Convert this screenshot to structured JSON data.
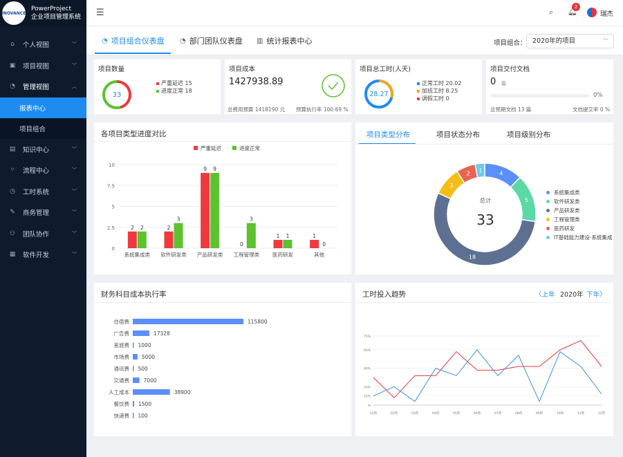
{
  "app": {
    "logo": "INOVANCE",
    "name": "PowerProject",
    "subtitle": "企业项目管理系统"
  },
  "topbar": {
    "notification_count": "2",
    "user": "瑞杰"
  },
  "sidebar": {
    "items": [
      {
        "label": "个人视图",
        "icon": "home-icon",
        "glyph": "⌂"
      },
      {
        "label": "项目视图",
        "icon": "project-icon",
        "glyph": "▣"
      },
      {
        "label": "管理视图",
        "icon": "dashboard-icon",
        "glyph": "◔"
      },
      {
        "label": "知识中心",
        "icon": "book-icon",
        "glyph": "▤"
      },
      {
        "label": "流程中心",
        "icon": "flow-icon",
        "glyph": "⑂"
      },
      {
        "label": "工时系统",
        "icon": "clock-icon",
        "glyph": "◷"
      },
      {
        "label": "商务管理",
        "icon": "contract-icon",
        "glyph": "✎"
      },
      {
        "label": "团队协作",
        "icon": "team-icon",
        "glyph": "⚇"
      },
      {
        "label": "软件开发",
        "icon": "grid-icon",
        "glyph": "▦"
      }
    ],
    "sub_items": [
      {
        "label": "报表中心"
      },
      {
        "label": "项目组合"
      }
    ]
  },
  "tabs": [
    {
      "label": "项目组合仪表盘"
    },
    {
      "label": "部门团队仪表盘"
    },
    {
      "label": "统计报表中心"
    }
  ],
  "portfolio": {
    "label": "项目组合：",
    "value": "2020年的项目"
  },
  "kpi": {
    "count": {
      "title": "项目数量",
      "value": "33",
      "legend": [
        "严重延迟 15",
        "进度正常 18"
      ],
      "severe": 15,
      "normal": 18
    },
    "cost": {
      "title": "项目成本",
      "value": "1427938.89",
      "unit": "元",
      "budget": "总费用预算 1418190 元",
      "rate": "预算执行率 100.69 %"
    },
    "hours": {
      "title": "项目总工时(人天)",
      "value": "28.27",
      "legend": [
        "正常工时 20.02",
        "加班工时 8.25",
        "调假工时 0"
      ],
      "normal": 20.02,
      "overtime": 8.25,
      "leave": 0
    },
    "docs": {
      "title": "项目交付文档",
      "value": "0",
      "unit": "篇",
      "percent": "0%",
      "planned": "总预期文档 13 篇",
      "submit_rate": "文档提交率 0 %"
    }
  },
  "colors": {
    "primary": "#1e8bf0",
    "red": "#ee3a3f",
    "green": "#5cc22f",
    "orange": "#f5a623",
    "sidebar": "#0f1b2d"
  },
  "progress_chart": {
    "title": "各项目类型进度对比",
    "chart_data": {
      "type": "bar",
      "categories": [
        "系统集成类",
        "软件研发类",
        "产品研发类",
        "工程管理类",
        "医药研发",
        "其他"
      ],
      "series": [
        {
          "name": "严重延迟",
          "values": [
            2,
            2,
            9,
            0,
            1,
            1
          ]
        },
        {
          "name": "进度正常",
          "values": [
            2,
            3,
            9,
            3,
            1,
            0
          ]
        }
      ],
      "yticks": [
        "0",
        "2.5",
        "5",
        "7.5",
        "10"
      ],
      "ylim": [
        0,
        10
      ],
      "legend_position": "top-center"
    }
  },
  "distribution": {
    "tabs": [
      "项目类型分布",
      "项目状态分布",
      "项目级别分布"
    ],
    "total_label": "总计",
    "total": "33",
    "chart_data": {
      "type": "pie",
      "labels": [
        "系统集成类",
        "软件研发类",
        "产品研发类",
        "工程管理类",
        "医药研发",
        "IT基础能力建设-系统集成"
      ],
      "values": [
        4,
        5,
        18,
        3,
        2,
        1
      ],
      "colors": [
        "#5b8ff9",
        "#5ad8a6",
        "#5d7092",
        "#f6bd16",
        "#e86452",
        "#6dc8ec"
      ],
      "legend_position": "right"
    }
  },
  "finance": {
    "title": "财务科目成本执行率",
    "chart_data": {
      "type": "bar",
      "orientation": "horizontal",
      "categories": [
        "住宿费",
        "广告费",
        "差旅费",
        "市场费",
        "通讯费",
        "交通费",
        "人工成本",
        "餐饮费",
        "快递费"
      ],
      "values": [
        115800,
        17328,
        1000,
        5000,
        500,
        7000,
        38900,
        1500,
        100
      ],
      "labels": [
        "115800",
        "17328",
        "1000",
        "5000",
        "500",
        "7000",
        "38900",
        "1500",
        "100"
      ]
    }
  },
  "trend": {
    "title": "工时投入趋势",
    "prev": "上年",
    "year": "2020年",
    "next": "下年",
    "chart_data": {
      "type": "line",
      "x": [
        "01月",
        "02月",
        "03月",
        "04月",
        "05月",
        "06月",
        "07月",
        "08月",
        "09月",
        "10月",
        "11月",
        "12月"
      ],
      "yticks": [
        "%",
        "10%",
        "20%",
        "40%",
        "60%",
        "75%"
      ],
      "series": [
        {
          "values": [
            30,
            8,
            32,
            32,
            58,
            38,
            38,
            42,
            42,
            60,
            70,
            42
          ],
          "color": "#e8353a"
        },
        {
          "values": [
            10,
            20,
            4,
            40,
            32,
            60,
            32,
            54,
            4,
            58,
            42,
            12
          ],
          "color": "#3b8fe0"
        }
      ]
    }
  }
}
